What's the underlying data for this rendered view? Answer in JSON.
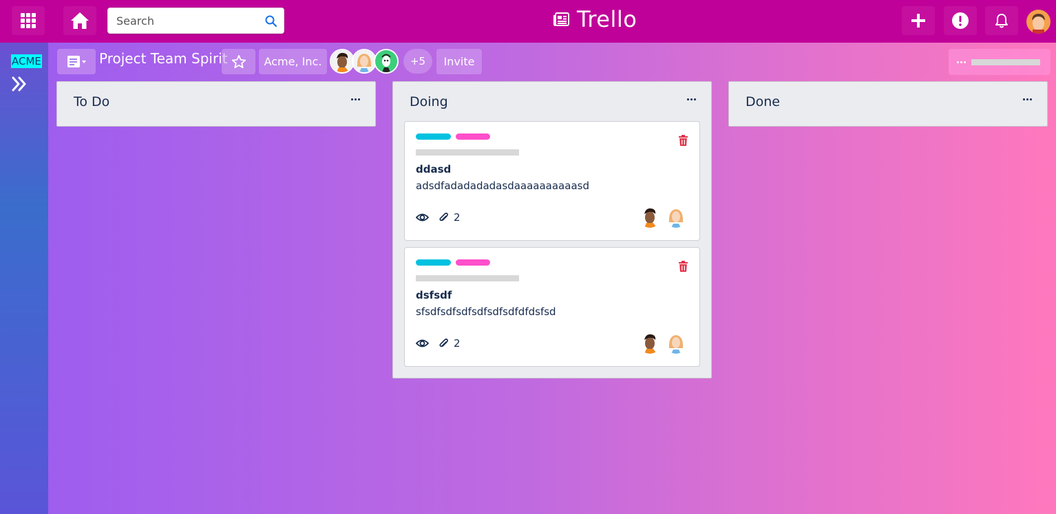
{
  "topbar": {
    "brand": "Trello",
    "search_placeholder": "Search"
  },
  "sidebar": {
    "workspace_label": "ACME"
  },
  "board": {
    "title": "Project Team Spirit",
    "org": "Acme, Inc.",
    "extra_members": "+5",
    "invite_label": "Invite"
  },
  "lists": [
    {
      "title": "To Do",
      "cards": []
    },
    {
      "title": "Doing",
      "cards": [
        {
          "title": "ddasd",
          "description": "adsdfadadadadasdaaaaaaaaaasd",
          "attachments": "2"
        },
        {
          "title": "dsfsdf",
          "description": "sfsdfsdfsdfsdfsdfsdfdfdsfsd",
          "attachments": "2"
        }
      ]
    },
    {
      "title": "Done",
      "cards": []
    }
  ],
  "colors": {
    "topbar": "#c00199",
    "label_cyan": "#00c2e0",
    "label_pink": "#ff4fcb",
    "trash": "#e0334a"
  }
}
